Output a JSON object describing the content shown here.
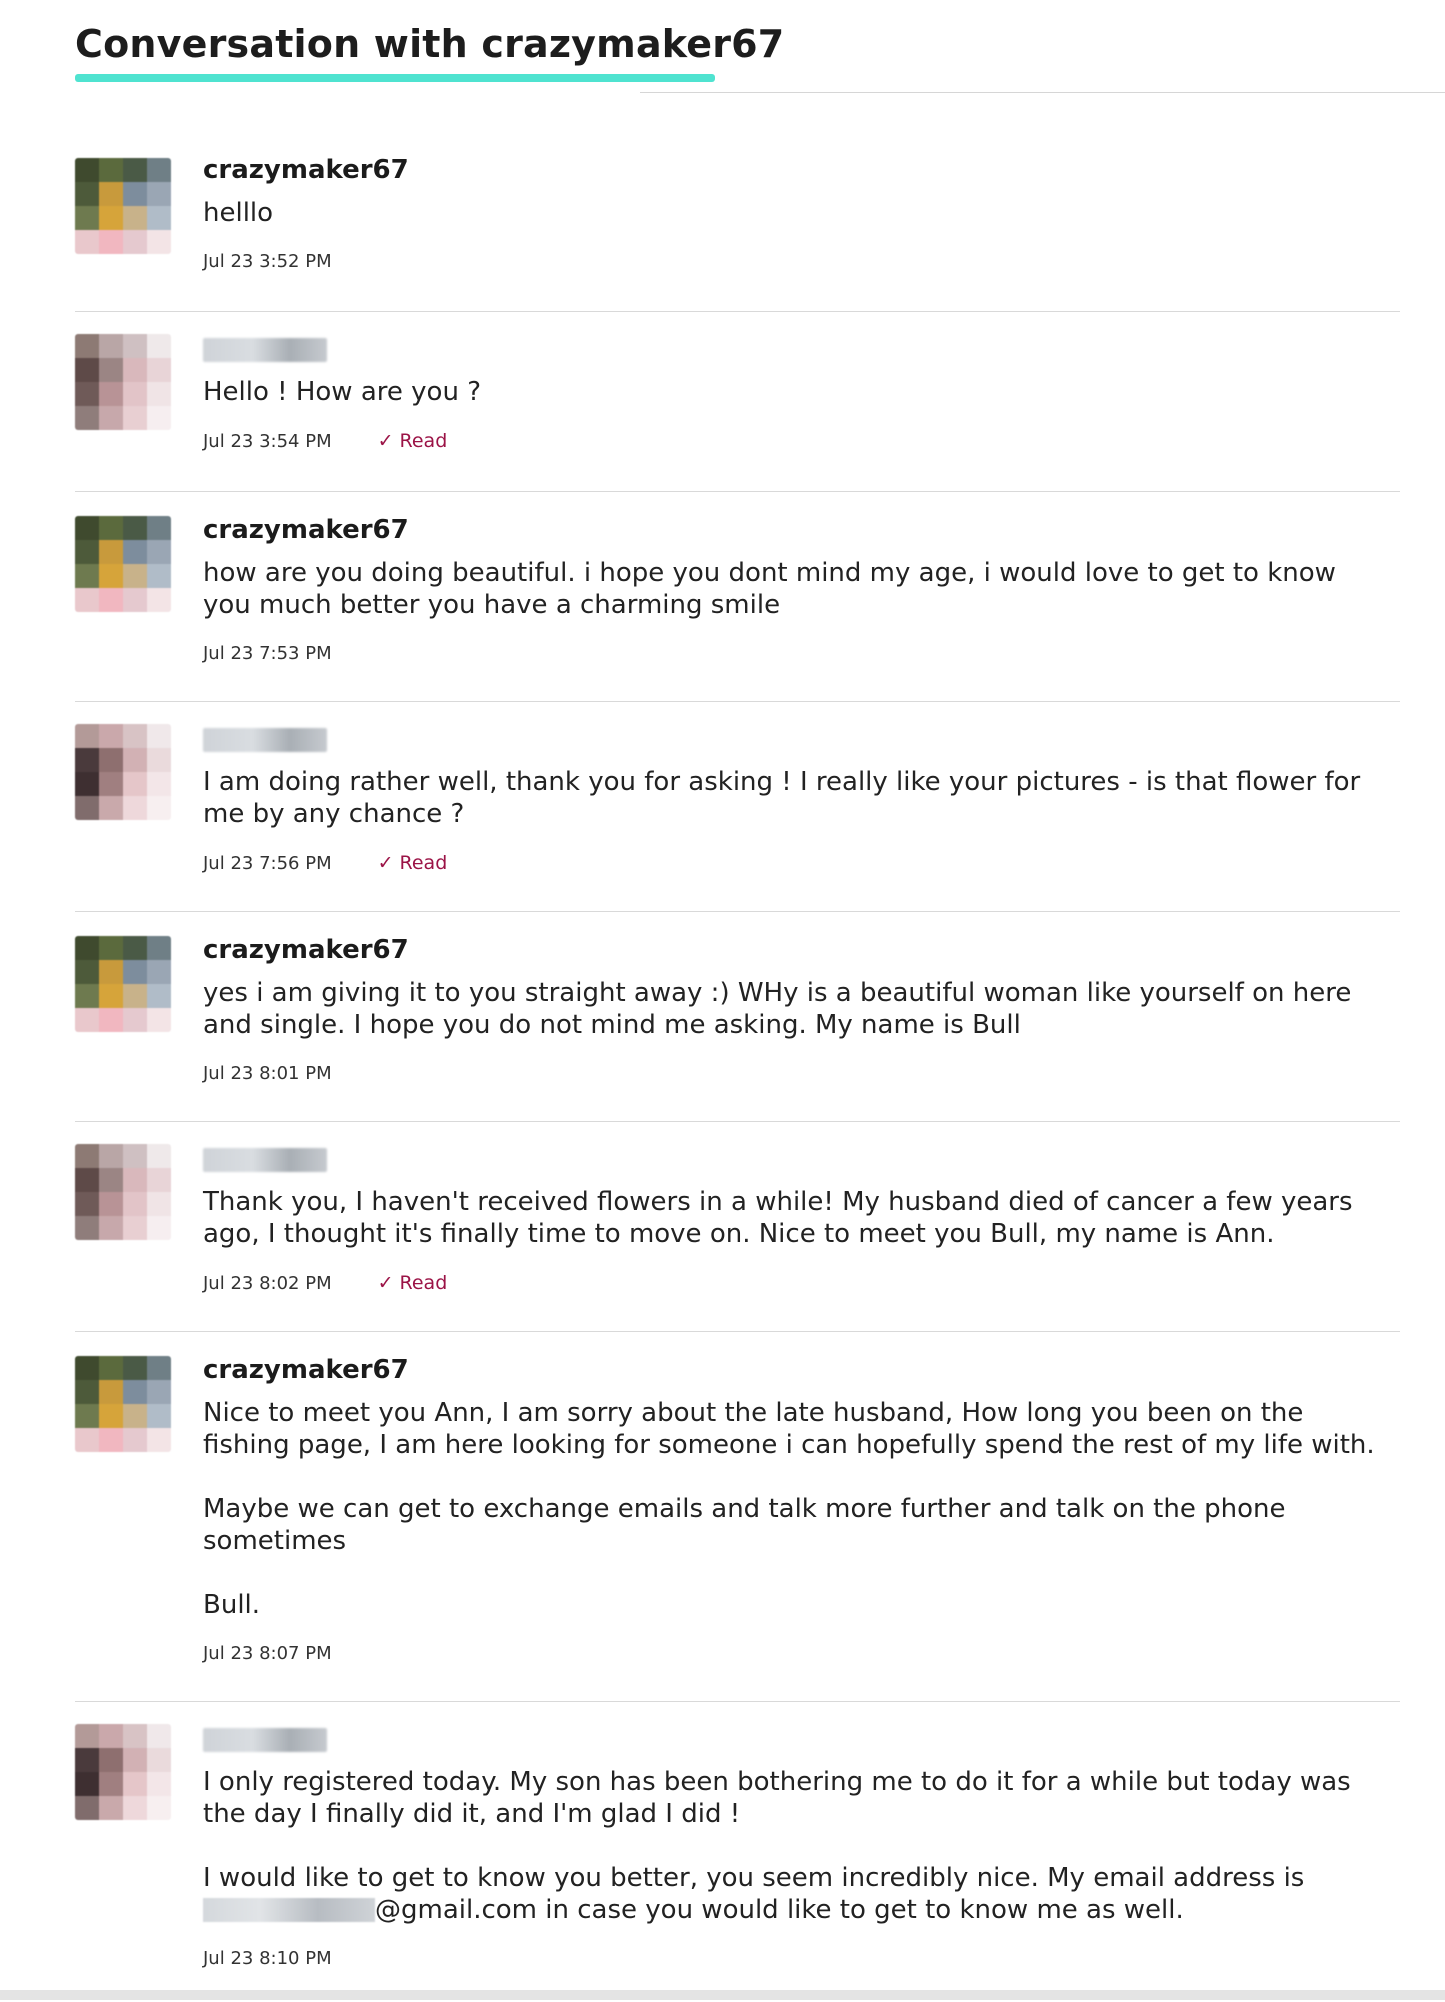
{
  "header": {
    "title": "Conversation with crazymaker67",
    "accent_color": "#4fe3d0"
  },
  "read_label": "Read",
  "read_color": "#9b1346",
  "messages": [
    {
      "from": "crazymaker67",
      "paragraphs": [
        "helllo"
      ],
      "time": "Jul 23 3:52 PM"
    },
    {
      "from": "",
      "paragraphs": [
        "Hello ! How are you ?"
      ],
      "time": "Jul 23 3:54 PM",
      "read": true
    },
    {
      "from": "crazymaker67",
      "paragraphs": [
        "how are you doing beautiful. i hope you dont mind my age, i would love to get to know you much better you have a charming smile"
      ],
      "time": "Jul 23 7:53 PM"
    },
    {
      "from": "",
      "paragraphs": [
        "I am doing rather well, thank you for asking ! I really like your pictures - is that flower for me by any chance ?"
      ],
      "time": "Jul 23 7:56 PM",
      "read": true
    },
    {
      "from": "crazymaker67",
      "paragraphs": [
        "yes i am giving it to you straight away :) WHy is a beautiful woman like yourself on here and single. I hope you do not mind me asking. My name is Bull"
      ],
      "time": "Jul 23 8:01 PM"
    },
    {
      "from": "",
      "paragraphs": [
        "Thank you, I haven't received flowers in a while! My husband died of cancer a few years ago, I thought it's finally time to move on. Nice to meet you Bull, my name is Ann."
      ],
      "time": "Jul 23 8:02 PM",
      "read": true
    },
    {
      "from": "crazymaker67",
      "paragraphs": [
        "Nice to meet you Ann, I am sorry about the late husband, How long you been on the fishing page, I am here looking for someone i can hopefully spend the rest of my life with.",
        "Maybe we can get to exchange emails and talk more further and talk on the phone sometimes",
        "Bull."
      ],
      "time": "Jul 23 8:07 PM"
    },
    {
      "from": "",
      "paragraphs": [
        "I only registered today. My son has been bothering me to do it for a while but today was the day I finally did it, and I'm glad I did !",
        "I would like to get to know you better, you seem incredibly nice. My email address is"
      ],
      "email_suffix": "@gmail.com in case you would like to get to know me as well.",
      "time": "Jul 23 8:10 PM"
    }
  ]
}
